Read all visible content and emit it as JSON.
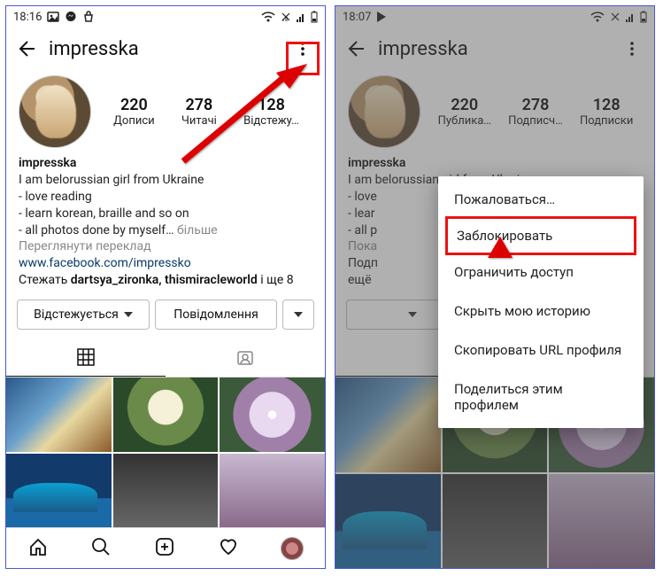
{
  "left": {
    "status": {
      "time": "18:16"
    },
    "header": {
      "username": "impresska"
    },
    "stats": [
      {
        "num": "220",
        "label": "Дописи"
      },
      {
        "num": "278",
        "label": "Читачі"
      },
      {
        "num": "128",
        "label": "Відстежу…"
      }
    ],
    "bio": {
      "name": "impresska",
      "l1": "I am belorussian girl from Ukraine",
      "l2": "- love reading",
      "l3": "- learn korean, braille and so on",
      "l4": "- all photos done by myself…",
      "more": "більше",
      "translate": "Переглянути переклад",
      "url": "www.facebook.com/impressko",
      "follow_prefix": "Стежать ",
      "follow_bold": "dartsya_zironka, thismiracleworld",
      "follow_suffix": " і ще 8"
    },
    "actions": {
      "following": "Відстежується",
      "message": "Повідомлення"
    }
  },
  "right": {
    "status": {
      "time": "18:07"
    },
    "header": {
      "username": "impresska"
    },
    "stats": [
      {
        "num": "220",
        "label": "Публика…"
      },
      {
        "num": "278",
        "label": "Подписч…"
      },
      {
        "num": "128",
        "label": "Подписки"
      }
    ],
    "bio": {
      "name": "impresska",
      "l1": "I am belorussian girl from Ukraine",
      "l2": "- love",
      "l3": "- lear",
      "l4": "- all p",
      "translate": "Пока",
      "follow_prefix": "Подп",
      "follow_suffix": "ещё"
    },
    "popup": {
      "report": "Пожаловаться…",
      "block": "Заблокировать",
      "restrict": "Ограничить доступ",
      "hide": "Скрыть мою историю",
      "copy": "Скопировать URL профиля",
      "share": "Поделиться этим профилем"
    }
  }
}
